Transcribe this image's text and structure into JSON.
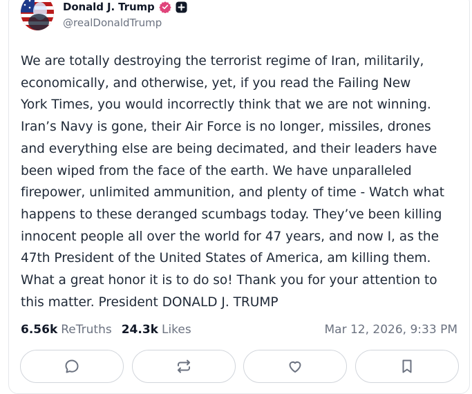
{
  "author": {
    "display_name": "Donald J. Trump",
    "handle": "@realDonaldTrump",
    "verified_color": "#e0457b"
  },
  "post": {
    "text": "We are totally destroying the terrorist regime of Iran, militarily,\neconomically, and otherwise, yet, if you read the Failing New\nYork Times, you would incorrectly think that we are not winning.\nIran’s Navy is gone, their Air Force is no longer, missiles, drones\nand everything else are being decimated, and their leaders have\nbeen wiped from the face of the earth. We have unparalleled\nfirepower, unlimited ammunition, and plenty of time - Watch what\nhappens to these deranged scumbags today. They’ve been killing\ninnocent people all over the world for 47 years, and now I, as the\n47th President of the United States of America, am killing them.\nWhat a great honor it is to do so! Thank you for your attention to\nthis matter. President DONALD J. TRUMP",
    "retruths_count": "6.56k",
    "retruths_label": "ReTruths",
    "likes_count": "24.3k",
    "likes_label": "Likes",
    "timestamp": "Mar 12, 2026, 9:33 PM"
  },
  "actions": [
    {
      "name": "reply",
      "icon": "speech-bubble-icon"
    },
    {
      "name": "retruth",
      "icon": "repost-arrows-icon"
    },
    {
      "name": "like",
      "icon": "heart-icon"
    },
    {
      "name": "bookmark",
      "icon": "bookmark-icon"
    }
  ],
  "colors": {
    "icon_gray": "#6b7280",
    "border_gray": "#d1d5db",
    "text_dark": "#1f2937"
  }
}
